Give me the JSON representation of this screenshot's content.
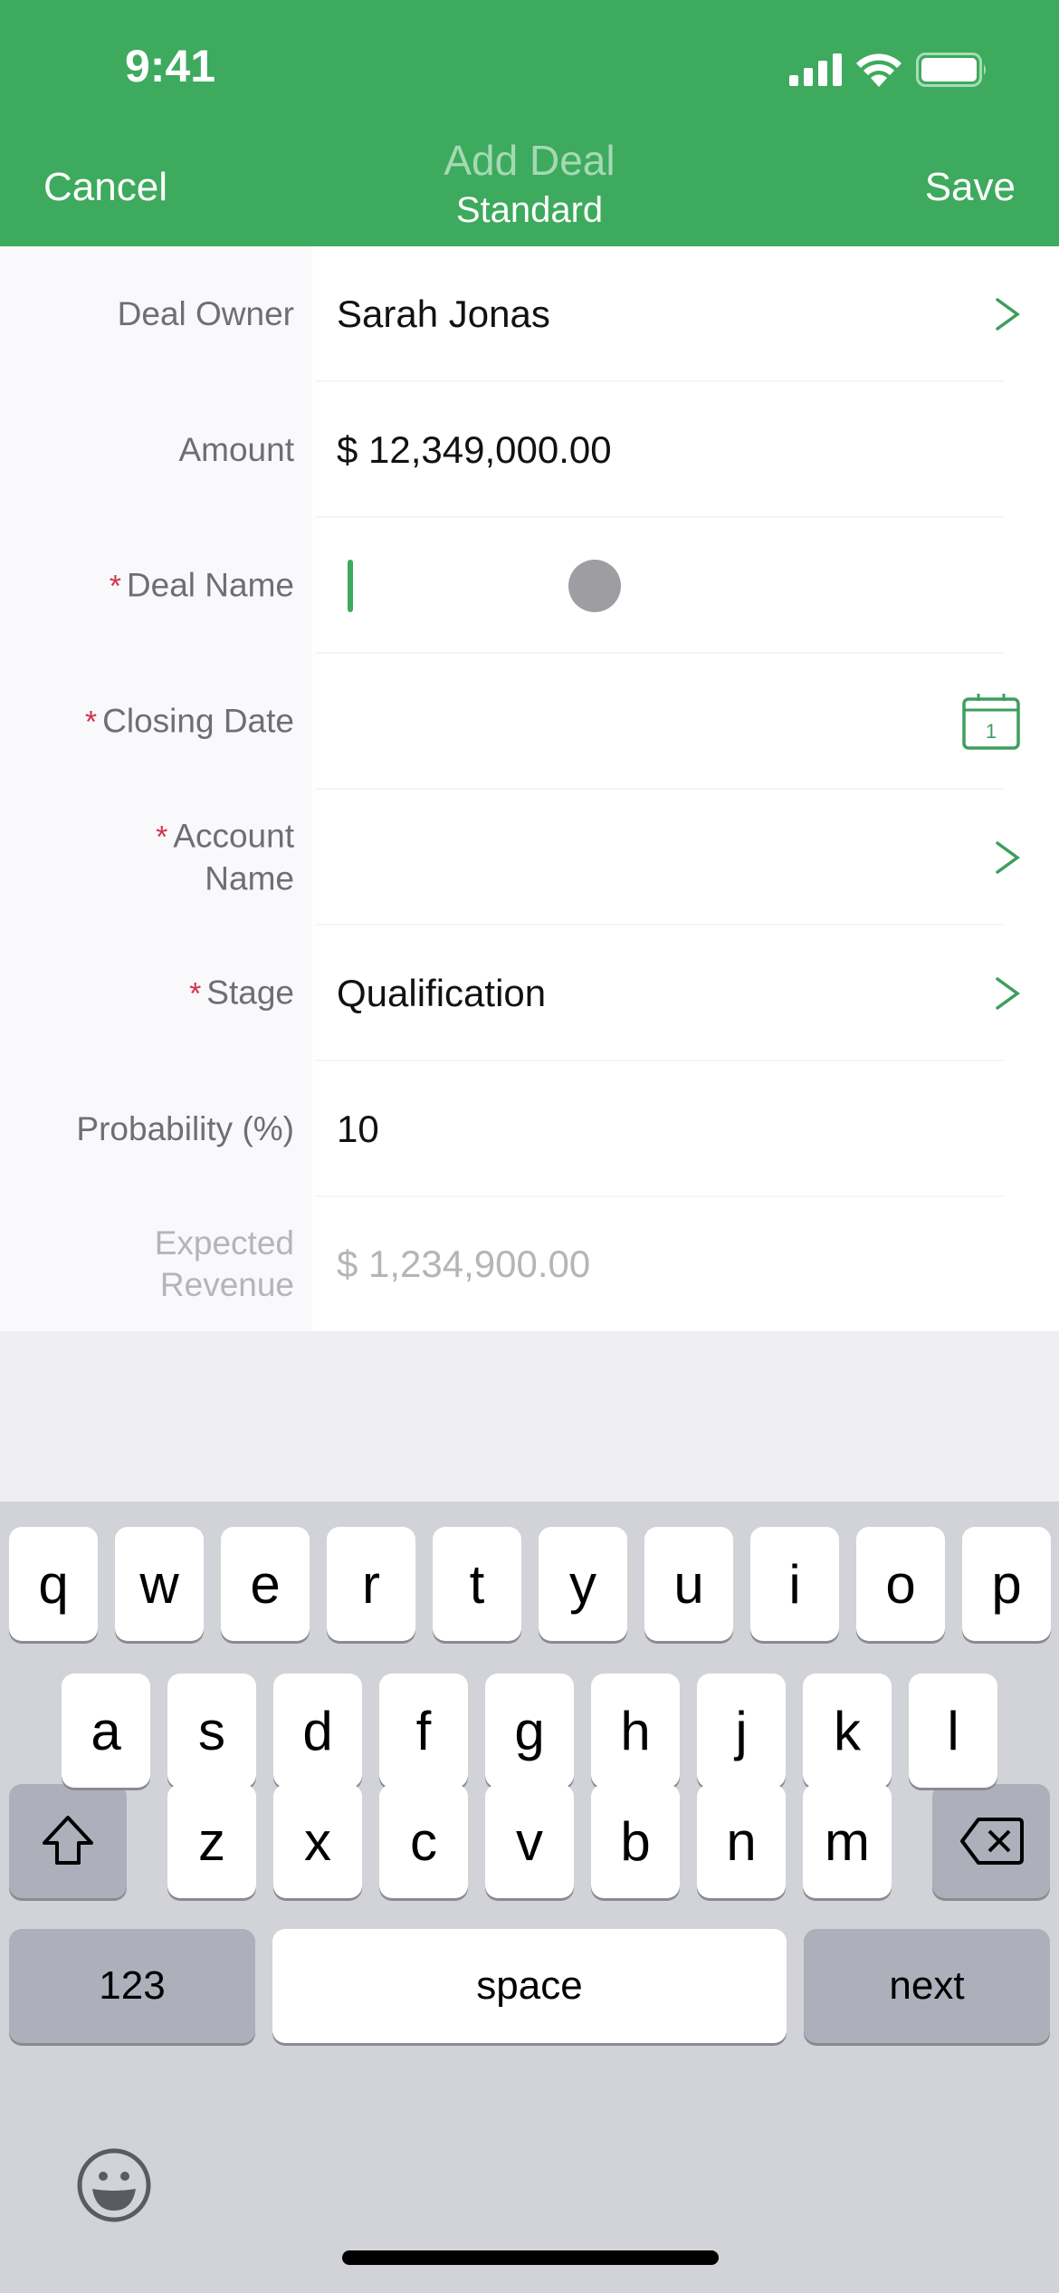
{
  "status_bar": {
    "time": "9:41"
  },
  "nav": {
    "cancel_label": "Cancel",
    "title": "Add Deal",
    "subtitle": "Standard",
    "save_label": "Save"
  },
  "form": {
    "fields": [
      {
        "label": "Deal Owner",
        "required": false,
        "value": "Sarah Jonas",
        "accessory": "chevron-right-icon"
      },
      {
        "label": "Amount",
        "required": false,
        "value": "$ 12,349,000.00",
        "accessory": ""
      },
      {
        "label": "Deal Name",
        "required": true,
        "value": "",
        "accessory": "",
        "focused": true
      },
      {
        "label": "Closing Date",
        "required": true,
        "value": "",
        "accessory": "calendar-icon",
        "calendar_day": "1"
      },
      {
        "label_line1": "Account",
        "label_line2": "Name",
        "label": "Account Name",
        "required": true,
        "value": "",
        "accessory": "chevron-right-icon"
      },
      {
        "label": "Stage",
        "required": true,
        "value": "Qualification",
        "accessory": "chevron-right-icon"
      },
      {
        "label": "Probability (%)",
        "required": false,
        "value": "10",
        "accessory": ""
      },
      {
        "label_line1": "Expected",
        "label_line2": "Revenue",
        "label": "Expected Revenue",
        "required": false,
        "value": "$ 1,234,900.00",
        "accessory": "",
        "disabled": true
      }
    ],
    "required_marker": "*"
  },
  "keyboard": {
    "row1": [
      "q",
      "w",
      "e",
      "r",
      "t",
      "y",
      "u",
      "i",
      "o",
      "p"
    ],
    "row2": [
      "a",
      "s",
      "d",
      "f",
      "g",
      "h",
      "j",
      "k",
      "l"
    ],
    "row3": [
      "z",
      "x",
      "c",
      "v",
      "b",
      "n",
      "m"
    ],
    "numbers_label": "123",
    "space_label": "space",
    "return_label": "next"
  },
  "colors": {
    "accent": "#3daa5d",
    "required": "#d0344a",
    "label": "#6f6e74",
    "keyboard_bg": "#d2d3d9"
  }
}
